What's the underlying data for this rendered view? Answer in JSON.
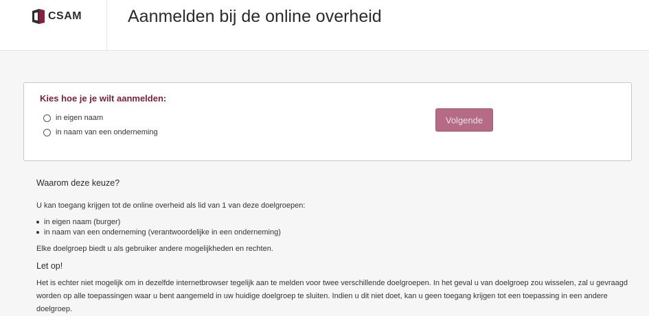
{
  "header": {
    "logo_text": "CSAM",
    "title": "Aanmelden bij de online overheid"
  },
  "choice": {
    "title": "Kies hoe je je wilt aanmelden:",
    "options": [
      {
        "label": "in eigen naam"
      },
      {
        "label": "in naam van een onderneming"
      }
    ],
    "next_label": "Volgende"
  },
  "info": {
    "heading": "Waarom deze keuze?",
    "intro": "U kan toegang krijgen tot de online overheid als lid van 1 van deze doelgroepen:",
    "bullets": [
      "in eigen naam (burger)",
      "in naam van een onderneming (verantwoordelijke in een onderneming)"
    ],
    "rights": "Elke doelgroep biedt u als gebruiker andere mogelijkheden en rechten.",
    "warning_heading": "Let op!",
    "warning_text": "Het is echter niet mogelijk om in dezelfde internetbrowser tegelijk aan te melden voor twee verschillende doelgroepen. In het geval u van doelgroep zou wisselen, zal u gevraagd worden op alle toepassingen waar u bent aangemeld in uw huidige doelgroep te sluiten. Indien u dit niet doet, kan u geen toegang krijgen tot een toepassing in een andere doelgroep."
  },
  "colors": {
    "accent": "#7a1e3e",
    "button_bg": "#b56a85"
  }
}
